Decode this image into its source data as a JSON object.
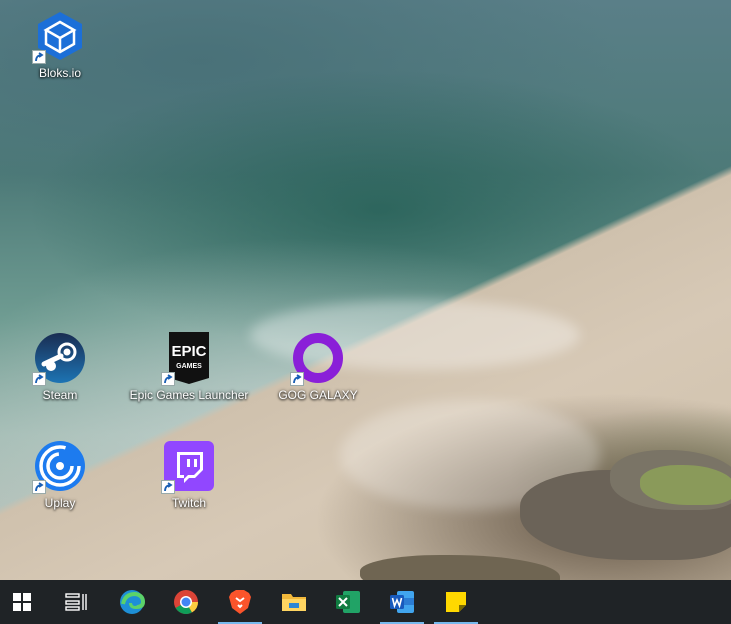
{
  "desktop": {
    "icons": [
      {
        "label": "Bloks.io",
        "icon": "bloks-cube-icon",
        "shortcut": true
      },
      {
        "label": "Steam",
        "icon": "steam-icon",
        "shortcut": true
      },
      {
        "label": "Epic Games Launcher",
        "icon": "epic-games-icon",
        "shortcut": true,
        "logo_text": [
          "EPIC",
          "GAMES"
        ]
      },
      {
        "label": "GOG GALAXY",
        "icon": "gog-galaxy-icon",
        "shortcut": true
      },
      {
        "label": "Uplay",
        "icon": "uplay-icon",
        "shortcut": true
      },
      {
        "label": "Twitch",
        "icon": "twitch-icon",
        "shortcut": true
      }
    ]
  },
  "taskbar": {
    "items": [
      {
        "name": "start-button",
        "icon": "windows-logo-icon",
        "active": false
      },
      {
        "name": "task-view-button",
        "icon": "task-view-icon",
        "active": false
      },
      {
        "name": "edge-button",
        "icon": "edge-icon",
        "active": false
      },
      {
        "name": "chrome-button",
        "icon": "chrome-icon",
        "active": false
      },
      {
        "name": "brave-button",
        "icon": "brave-icon",
        "active": true
      },
      {
        "name": "file-explorer-button",
        "icon": "folder-icon",
        "active": false
      },
      {
        "name": "excel-button",
        "icon": "excel-icon",
        "active": false
      },
      {
        "name": "word-button",
        "icon": "word-icon",
        "active": true
      },
      {
        "name": "sticky-notes-button",
        "icon": "sticky-notes-icon",
        "active": true
      }
    ],
    "colors": {
      "background": "#1f2326",
      "active_indicator": "#76b9ed"
    }
  }
}
